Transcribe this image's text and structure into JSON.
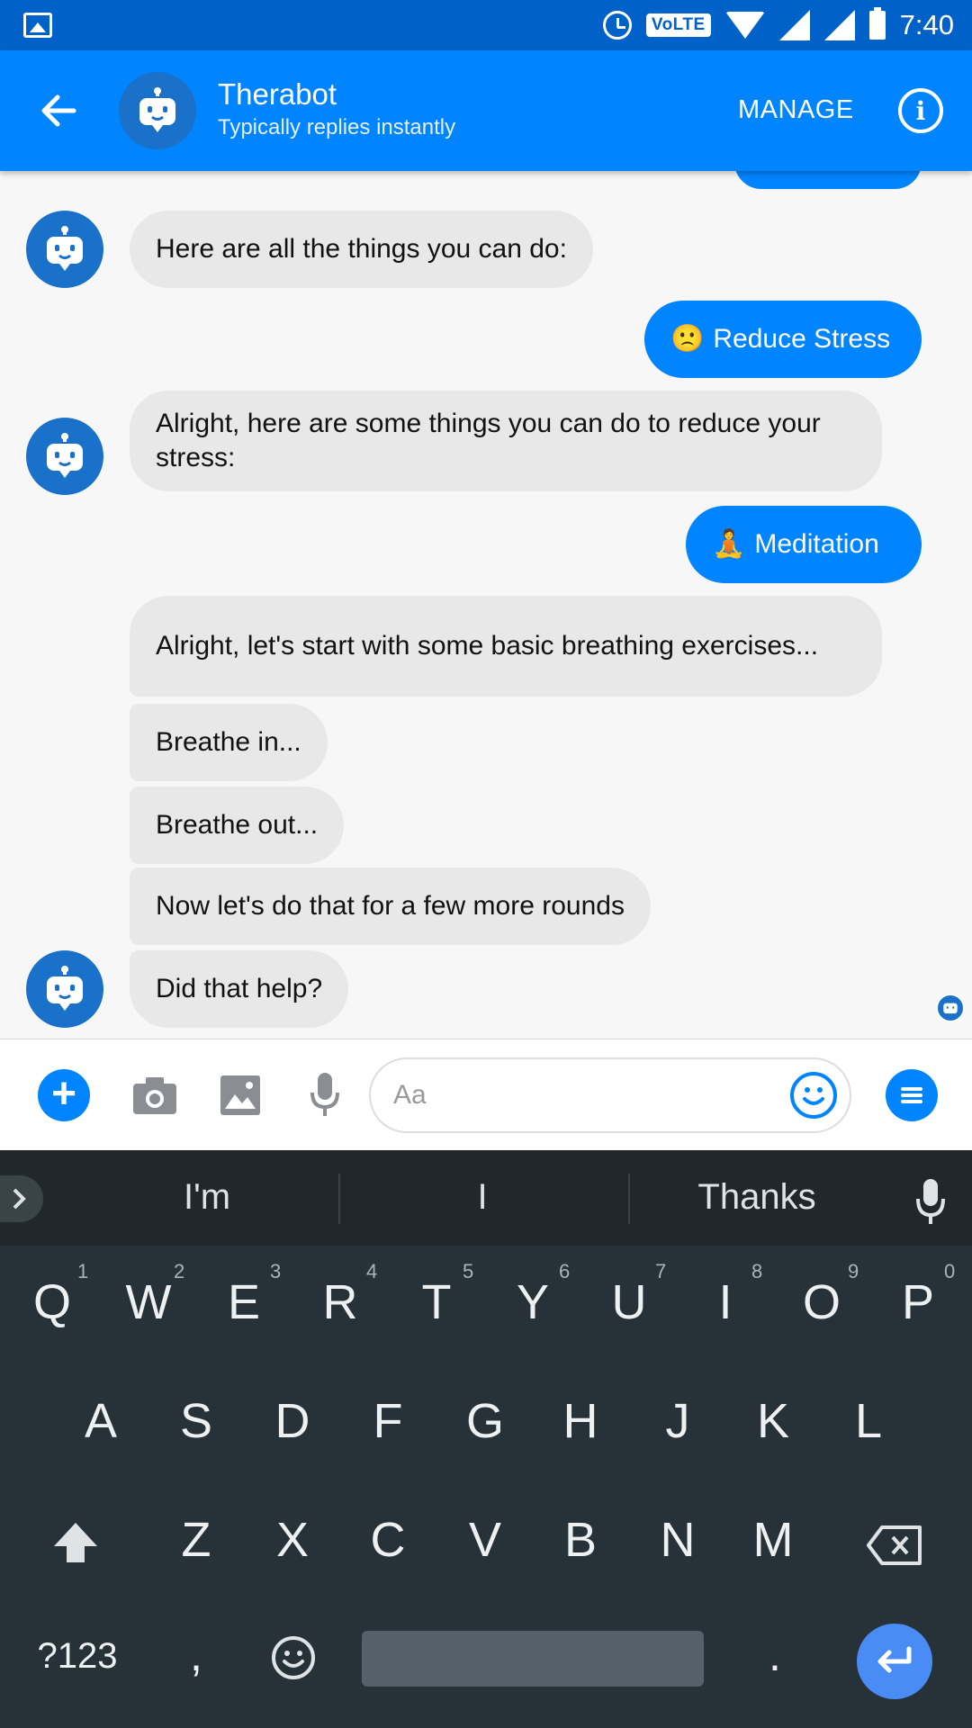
{
  "status_bar": {
    "time": "7:40",
    "volte": "VoLTE"
  },
  "header": {
    "title": "Therabot",
    "subtitle": "Typically replies instantly",
    "manage": "MANAGE"
  },
  "messages": {
    "m1": "Here are all the things you can do:",
    "m2_emoji": "🙁",
    "m2": "Reduce Stress",
    "m3": "Alright, here are some things you can do to reduce your stress:",
    "m4_emoji": "🧘",
    "m4": "Meditation",
    "m5": "Alright, let's start with some basic breathing exercises...",
    "m6": "Breathe in...",
    "m7": "Breathe out...",
    "m8": "Now let's do that for a few more rounds",
    "m9": "Did that help?"
  },
  "composer": {
    "placeholder": "Aa"
  },
  "keyboard": {
    "suggestions": [
      "I'm",
      "I",
      "Thanks"
    ],
    "row1": [
      "Q",
      "W",
      "E",
      "R",
      "T",
      "Y",
      "U",
      "I",
      "O",
      "P"
    ],
    "row1_nums": [
      "1",
      "2",
      "3",
      "4",
      "5",
      "6",
      "7",
      "8",
      "9",
      "0"
    ],
    "row2": [
      "A",
      "S",
      "D",
      "F",
      "G",
      "H",
      "J",
      "K",
      "L"
    ],
    "row3": [
      "Z",
      "X",
      "C",
      "V",
      "B",
      "N",
      "M"
    ],
    "symbols": "?123",
    "comma": ",",
    "period": "."
  },
  "colors": {
    "accent": "#0084ff",
    "statusbar": "#0061c8",
    "keyboard_bg": "#263238"
  }
}
